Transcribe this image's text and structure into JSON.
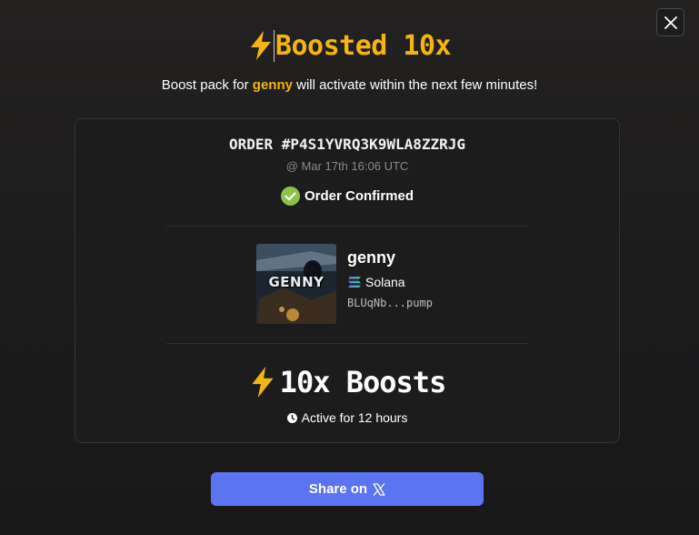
{
  "header": {
    "title": "Boosted 10x",
    "subtitle_prefix": "Boost pack for ",
    "subtitle_token": "genny",
    "subtitle_suffix": " will activate within the next few minutes!"
  },
  "order": {
    "id": "ORDER #P4S1YVRQ3K9WLA8ZZRJG",
    "time": "@ Mar 17th 16:06 UTC",
    "status": "Order Confirmed"
  },
  "token": {
    "name": "genny",
    "image_text": "GENNY",
    "chain": "Solana",
    "address": "BLUqNb...pump"
  },
  "boost": {
    "label": "10x Boosts",
    "duration": "Active for 12 hours"
  },
  "share": {
    "label": "Share on"
  },
  "colors": {
    "accent": "#f3b511",
    "share_button": "#5b74f0",
    "confirmed": "#8bc34a"
  },
  "icons": {
    "close": "close-icon",
    "bolt": "lightning-bolt-icon",
    "check": "check-circle-icon",
    "chain": "solana-icon",
    "clock": "clock-icon",
    "x": "x-logo-icon"
  }
}
